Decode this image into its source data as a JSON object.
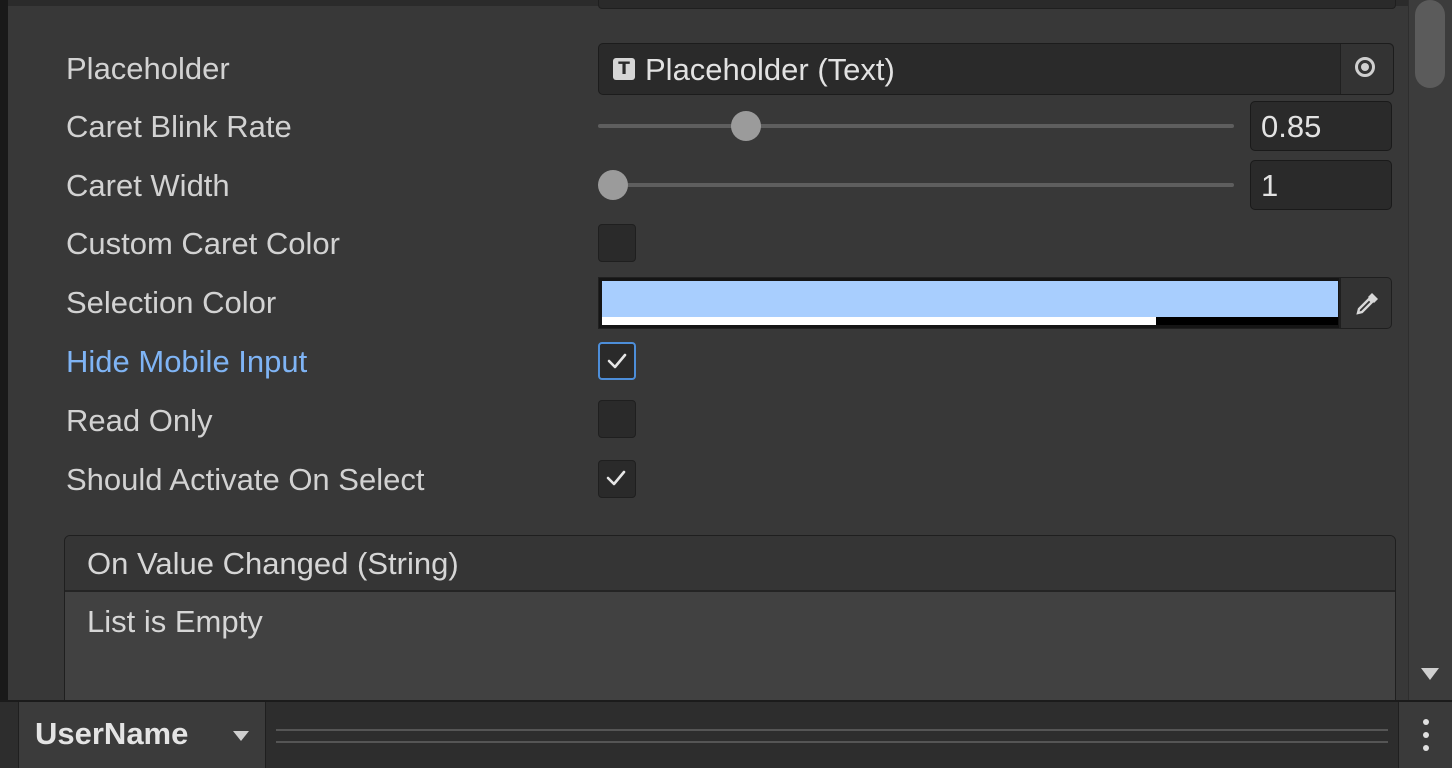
{
  "inspector": {
    "placeholder": {
      "label": "Placeholder",
      "value": "Placeholder (Text)"
    },
    "caret_blink_rate": {
      "label": "Caret Blink Rate",
      "value": "0.85",
      "slider_fraction": 0.22
    },
    "caret_width": {
      "label": "Caret Width",
      "value": "1",
      "slider_fraction": 0.0
    },
    "custom_caret_color": {
      "label": "Custom Caret Color",
      "checked": false
    },
    "selection_color": {
      "label": "Selection Color",
      "rgb": "#a8cefe",
      "alpha_fraction": 0.753
    },
    "hide_mobile_input": {
      "label": "Hide Mobile Input",
      "checked": true
    },
    "read_only": {
      "label": "Read Only",
      "checked": false
    },
    "should_activate_on_select": {
      "label": "Should Activate On Select",
      "checked": true
    }
  },
  "event": {
    "title": "On Value Changed (String)",
    "empty_text": "List is Empty"
  },
  "bottom_bar": {
    "object_name": "UserName"
  },
  "colors": {
    "modified_label": "#7fb4f5",
    "focus_outline": "#4d8ed9"
  }
}
